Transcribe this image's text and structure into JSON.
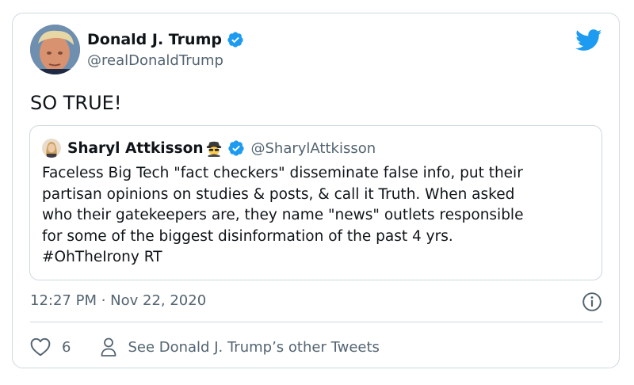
{
  "tweet": {
    "author_name": "Donald J. Trump",
    "author_handle": "@realDonaldTrump",
    "text": "SO TRUE!",
    "timestamp": "12:27 PM · Nov 22, 2020",
    "like_count": "6",
    "other_tweets_label": "See Donald J. Trump’s other Tweets"
  },
  "quoted": {
    "author_name": "Sharyl Attkisson",
    "author_handle": "@SharylAttkisson",
    "text_lines": [
      "Faceless Big Tech \"fact checkers\" disseminate false info, put their",
      "partisan opinions on studies & posts, & call it Truth. When asked",
      "who their gatekeepers are, they name \"news\" outlets responsible",
      "for some of the biggest disinformation of the past 4 yrs.",
      "#OhTheIrony RT"
    ]
  },
  "colors": {
    "twitter_blue": "#1d9bf0",
    "secondary_text": "#536471",
    "border": "#cfd9de"
  },
  "icons": [
    "twitter-bird-icon",
    "verified-badge-icon",
    "spy-emoji-icon",
    "info-icon",
    "heart-icon",
    "person-icon"
  ]
}
